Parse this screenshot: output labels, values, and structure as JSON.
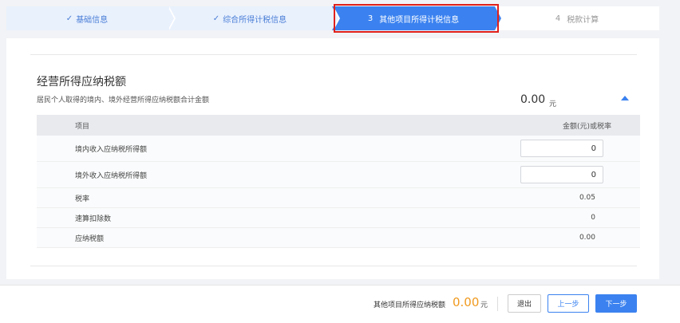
{
  "stepper": {
    "steps": [
      {
        "check": "✓",
        "label": "基础信息"
      },
      {
        "check": "✓",
        "label": "综合所得计税信息"
      },
      {
        "num": "3",
        "label": "其他项目所得计税信息"
      },
      {
        "num": "4",
        "label": "税款计算"
      }
    ],
    "active_index": 2
  },
  "section": {
    "title": "经营所得应纳税额",
    "description": "居民个人取得的境内、境外经营所得应纳税额合计金额",
    "total_amount": "0.00",
    "total_unit": "元"
  },
  "table": {
    "headers": [
      "项目",
      "金额(元)或税率"
    ],
    "rows": [
      {
        "label": "境内收入应纳税所得额",
        "type": "input",
        "value": "0"
      },
      {
        "label": "境外收入应纳税所得额",
        "type": "input",
        "value": "0"
      },
      {
        "label": "税率",
        "type": "text",
        "value": "0.05"
      },
      {
        "label": "速算扣除数",
        "type": "text",
        "value": "0"
      },
      {
        "label": "应纳税额",
        "type": "text",
        "value": "0.00"
      }
    ]
  },
  "footer": {
    "label": "其他项目所得应纳税额",
    "amount": "0.00",
    "unit": "元",
    "exit_label": "退出",
    "prev_label": "上一步",
    "next_label": "下一步"
  },
  "colors": {
    "accent": "#3b82f0",
    "highlight": "#e0201b",
    "amount": "#f09a1f"
  }
}
